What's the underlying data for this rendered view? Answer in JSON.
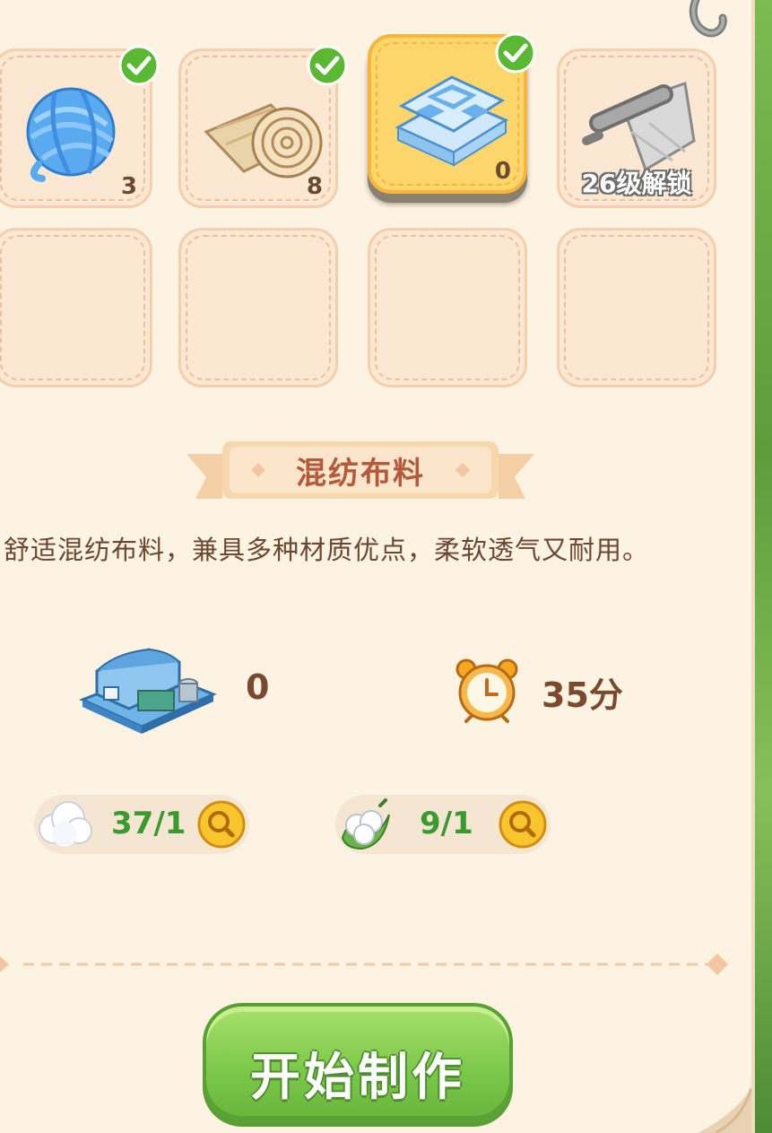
{
  "slots": [
    {
      "name": "yarn",
      "count": "3",
      "checked": true
    },
    {
      "name": "fabric-roll",
      "count": "8",
      "checked": true
    },
    {
      "name": "blended-fabric",
      "count": "0",
      "checked": true,
      "selected": true
    },
    {
      "name": "silk-roll",
      "lock_text": "26级解锁",
      "locked": true
    }
  ],
  "title": "混纺布料",
  "description": "舒适混纺布料，兼具多种材质优点，柔软透气又耐用。",
  "stats": {
    "factory_count": "0",
    "time": "35分"
  },
  "materials": [
    {
      "icon": "cotton-fluff-icon",
      "count": "37/1"
    },
    {
      "icon": "cotton-boll-icon",
      "count": "9/1"
    }
  ],
  "start_button": "开始制作",
  "colors": {
    "panel": "#fdf3e2",
    "accent_title": "#b45a3a",
    "button_green": "#7cc84a",
    "count_green": "#3a9a2e"
  }
}
